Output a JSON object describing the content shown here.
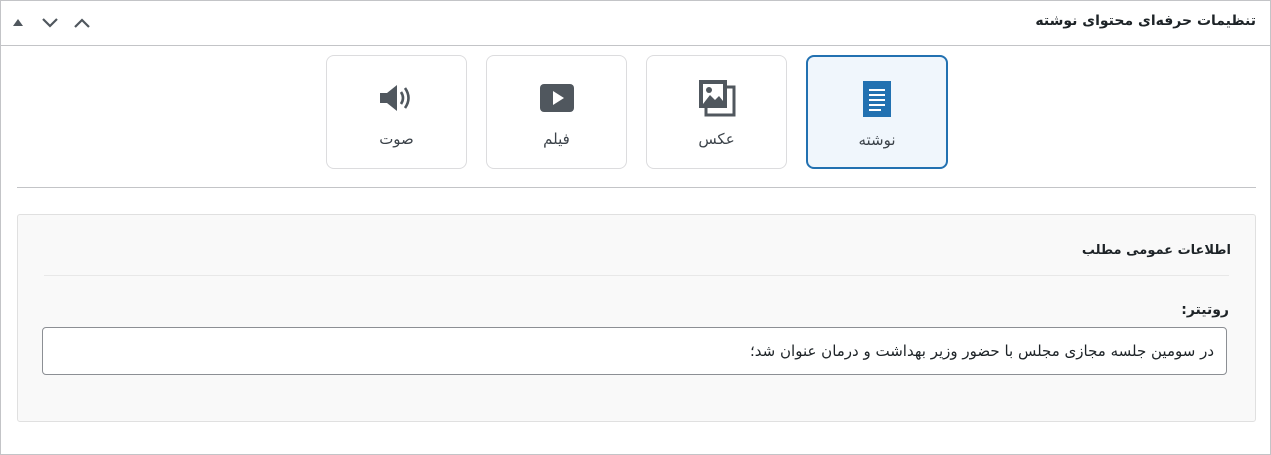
{
  "panel": {
    "title": "تنظیمات حرفه‌ای محتوای نوشته"
  },
  "formats": [
    {
      "label": "نوشته",
      "icon": "document-icon",
      "selected": true
    },
    {
      "label": "عکس",
      "icon": "gallery-icon",
      "selected": false
    },
    {
      "label": "فیلم",
      "icon": "video-icon",
      "selected": false
    },
    {
      "label": "صوت",
      "icon": "audio-icon",
      "selected": false
    }
  ],
  "general_info": {
    "title": "اطلاعات عمومی مطلب",
    "lead_label": "روتیتر:",
    "lead_value": "در سومین جلسه مجازی مجلس با حضور وزیر بهداشت و درمان عنوان شد؛"
  },
  "colors": {
    "accent": "#2271b1",
    "icon": "#50575e"
  }
}
